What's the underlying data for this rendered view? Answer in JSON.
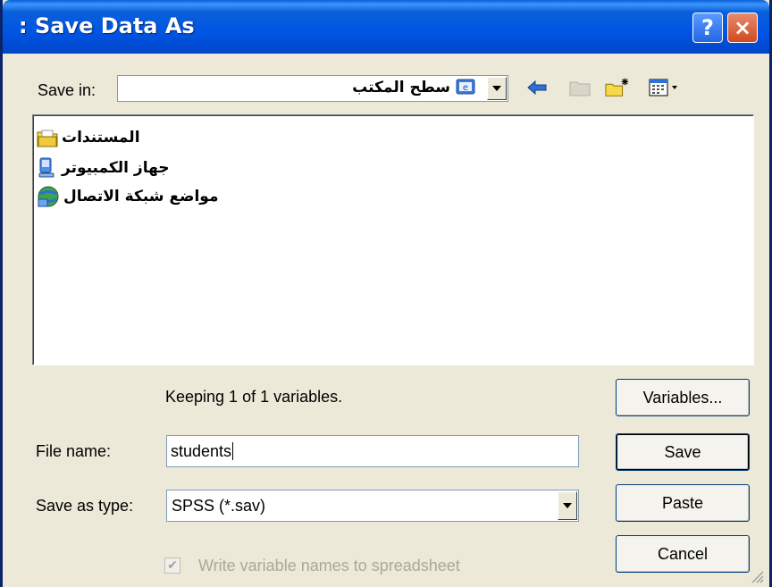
{
  "window": {
    "title": ": Save Data As",
    "help_label": "?",
    "close_label": "×"
  },
  "save_in": {
    "label": "Save in:",
    "value": "سطح المكتب"
  },
  "files": [
    {
      "name": "المستندات",
      "icon": "documents-folder-icon"
    },
    {
      "name": "جهاز الكمبيوتر",
      "icon": "my-computer-icon"
    },
    {
      "name": "مواضع شبكة الاتصال",
      "icon": "network-places-icon"
    }
  ],
  "status_text": "Keeping 1 of 1 variables.",
  "file_name": {
    "label": "File name:",
    "value": "students"
  },
  "save_as_type": {
    "label": "Save as type:",
    "value": "SPSS (*.sav)"
  },
  "checkbox": {
    "label": "Write variable names to spreadsheet",
    "checked": true,
    "enabled": false
  },
  "buttons": {
    "variables": "Variables...",
    "save": "Save",
    "paste": "Paste",
    "cancel": "Cancel"
  },
  "colors": {
    "titlebar": "#0055e5",
    "face": "#ece9d8",
    "button_border": "#003c74"
  }
}
